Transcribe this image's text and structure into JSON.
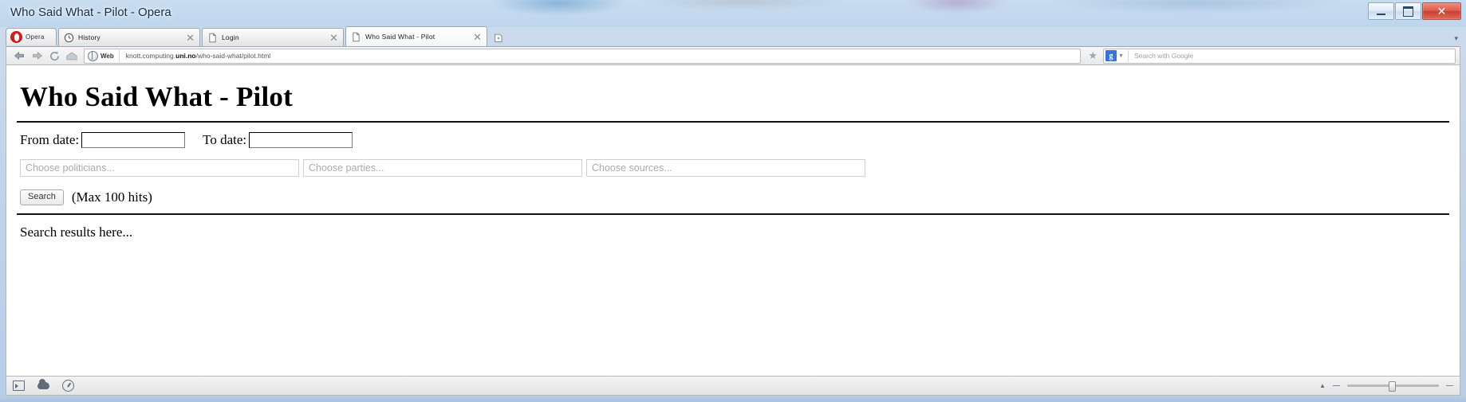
{
  "window": {
    "title": "Who Said What - Pilot - Opera",
    "buttons": {
      "minimize": "minimize-button",
      "maximize": "maximize-button",
      "close": "✕"
    }
  },
  "tabstrip": {
    "opera_menu_label": "Opera",
    "new_tab_label": "+",
    "tabs": [
      {
        "title": "History",
        "icon": "clock-icon",
        "close": "✕",
        "active": false
      },
      {
        "title": "Login",
        "icon": "page-icon",
        "close": "✕",
        "active": false
      },
      {
        "title": "Who Said What - Pilot",
        "icon": "page-icon",
        "close": "✕",
        "active": true
      }
    ]
  },
  "navbar": {
    "back_icon": "←",
    "forward_icon": "→",
    "reload_icon": "⟳",
    "home_icon": "⌂",
    "badge_text": "Web",
    "url_prefix": "knott.computing.",
    "url_host": "uni.no",
    "url_suffix": "/who-said-what/pilot.html",
    "url_full": "knott.computing.uni.no/who-said-what/pilot.html",
    "star_icon": "★",
    "search_engine_glyph": "g",
    "search_caret": "▼",
    "search_placeholder": "Search with Google"
  },
  "page": {
    "heading": "Who Said What - Pilot",
    "from_date_label": "From date:",
    "from_date_value": "",
    "to_date_label": "To date:",
    "to_date_value": "",
    "choosers": [
      {
        "placeholder": "Choose politicians...",
        "value": ""
      },
      {
        "placeholder": "Choose parties...",
        "value": ""
      },
      {
        "placeholder": "Choose sources...",
        "value": ""
      }
    ],
    "search_button": "Search",
    "max_hits_note": "(Max 100 hits)",
    "results_placeholder": "Search results here..."
  },
  "statusbar": {
    "panel_icon": "panel-icon",
    "link_icon": "cloud-icon",
    "speeddial_icon": "gauge-icon",
    "zoom_caret": "▲",
    "zoom_value": "100%"
  },
  "colors": {
    "chrome_glass": "#c3d6ea",
    "accent_red": "#c4141a",
    "google_blue": "#3c73d6",
    "close_red": "#c6402f"
  }
}
